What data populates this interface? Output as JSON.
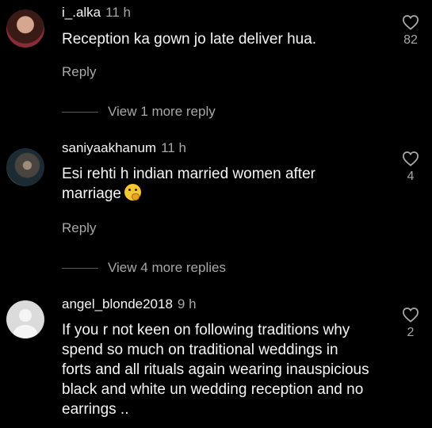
{
  "comments": [
    {
      "username": "i_.alka",
      "time": "11 h",
      "text": "Reception ka gown jo late deliver hua.",
      "likes": "82",
      "reply_label": "Reply",
      "more_replies": "View 1 more reply"
    },
    {
      "username": "saniyaakhanum",
      "time": "11 h",
      "text": "Esi rehti h indian married women after marriage",
      "emoji": "shushing-face-emoji",
      "likes": "4",
      "reply_label": "Reply",
      "more_replies": "View 4 more replies"
    },
    {
      "username": "angel_blonde2018",
      "time": "9 h",
      "text": "If you r not keen on following traditions why spend so much on traditional weddings in forts and all rituals again wearing inauspicious black and white un wedding reception and no earrings ..",
      "likes": "2"
    }
  ],
  "colors": {
    "background": "#000000",
    "primary_text": "#f5f5f5",
    "secondary_text": "#a8a8a8",
    "divider": "#5a5a5a"
  },
  "icons": [
    "heart-icon",
    "avatar-photo",
    "default-avatar-icon"
  ]
}
